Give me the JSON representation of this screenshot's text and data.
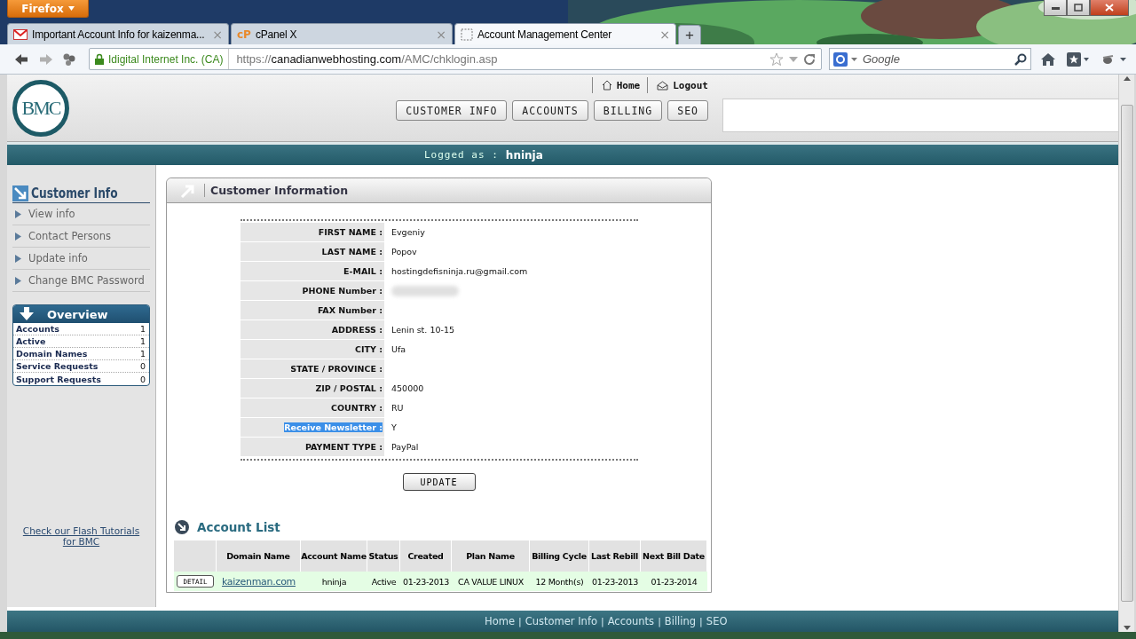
{
  "browser": {
    "menu_button": "Firefox",
    "tabs": [
      {
        "kind": "gmail",
        "title": "Important Account Info for kaizenma...",
        "selected": false
      },
      {
        "kind": "cpanel",
        "icon_text": "cP",
        "title": "cPanel X",
        "selected": false
      },
      {
        "kind": "blank",
        "title": "Account Management Center",
        "selected": true
      }
    ],
    "new_tab": "+",
    "close": "×",
    "identity": "Idigital Internet Inc. (CA)",
    "url_scheme": "https://",
    "url_host": "canadianwebhosting.com",
    "url_path": "/AMC/chklogin.asp",
    "search": {
      "placeholder": "Google"
    }
  },
  "header": {
    "logo": "BMC",
    "top_links": [
      {
        "kind": "home",
        "label": "Home"
      },
      {
        "kind": "logout",
        "label": "Logout"
      }
    ],
    "nav": [
      {
        "label": "CUSTOMER INFO"
      },
      {
        "label": "ACCOUNTS"
      },
      {
        "label": "BILLING"
      },
      {
        "label": "SEO"
      }
    ],
    "logged_as_label": "Logged as :",
    "logged_as_user": "hninja"
  },
  "sidebar": {
    "title": "Customer Info",
    "items": [
      {
        "label": "View info"
      },
      {
        "label": "Contact Persons"
      },
      {
        "label": "Update info"
      },
      {
        "label": "Change BMC Password"
      }
    ],
    "overview": {
      "title": "Overview",
      "rows": [
        {
          "label": "Accounts",
          "value": "1"
        },
        {
          "label": "Active",
          "value": "1"
        },
        {
          "label": "Domain Names",
          "value": "1"
        },
        {
          "label": "Service Requests",
          "value": "0"
        },
        {
          "label": "Support Requests",
          "value": "0"
        }
      ]
    },
    "tutorial_link": "Check our Flash Tutorials for BMC"
  },
  "customer_info": {
    "title": "Customer Information",
    "fields": [
      {
        "label": "FIRST NAME :",
        "value": "Evgeniy",
        "highlighted": false,
        "blurred": false
      },
      {
        "label": "LAST NAME :",
        "value": "Popov",
        "highlighted": false,
        "blurred": false
      },
      {
        "label": "E-MAIL :",
        "value": "hostingdefisninja.ru@gmail.com",
        "highlighted": false,
        "blurred": false
      },
      {
        "label": "PHONE Number :",
        "highlighted": false,
        "blurred": true
      },
      {
        "label": "FAX Number :",
        "highlighted": false,
        "blurred": false
      },
      {
        "label": "ADDRESS :",
        "value": "Lenin st. 10-15",
        "highlighted": false,
        "blurred": false
      },
      {
        "label": "CITY :",
        "value": "Ufa",
        "highlighted": false,
        "blurred": false
      },
      {
        "label": "STATE / PROVINCE :",
        "highlighted": false,
        "blurred": false
      },
      {
        "label": "ZIP / POSTAL :",
        "value": "450000",
        "highlighted": false,
        "blurred": false
      },
      {
        "label": "COUNTRY :",
        "value": "RU",
        "highlighted": false,
        "blurred": false
      },
      {
        "label": "Receive Newsletter :",
        "value": "Y",
        "highlighted": true,
        "blurred": false
      },
      {
        "label": "PAYMENT TYPE :",
        "value": "PayPal",
        "highlighted": false,
        "blurred": false
      }
    ],
    "update_button": "UPDATE"
  },
  "account_list": {
    "title": "Account List",
    "columns": [
      "Domain Name",
      "Account Name",
      "Status",
      "Created",
      "Plan Name",
      "Billing Cycle",
      "Last Rebill",
      "Next Bill Date"
    ],
    "rows": [
      {
        "button": "DETAIL",
        "cells": [
          "kaizenman.com",
          "hninja",
          "Active",
          "01-23-2013",
          "CA VALUE LINUX",
          "12 Month(s)",
          "01-23-2013",
          "01-23-2014"
        ]
      }
    ]
  },
  "footer": {
    "separator": "|",
    "links": [
      "Home",
      "Customer Info",
      "Accounts",
      "Billing",
      "SEO"
    ]
  }
}
